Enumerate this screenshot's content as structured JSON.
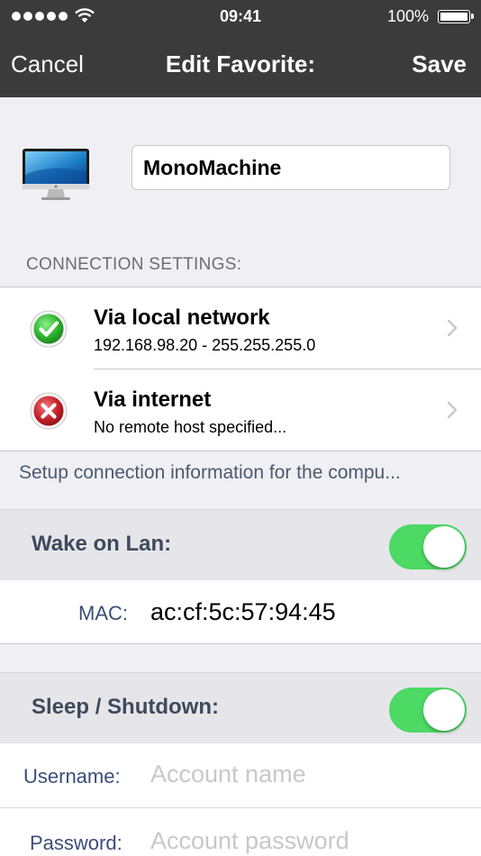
{
  "status_bar": {
    "time": "09:41",
    "battery": "100%",
    "battery_level": 1.0
  },
  "nav": {
    "left": "Cancel",
    "title": "Edit Favorite:",
    "right": "Save"
  },
  "favorite": {
    "icon": "computer-monitor-icon",
    "name": "MonoMachine"
  },
  "connection": {
    "header": "CONNECTION SETTINGS:",
    "items": [
      {
        "title": "Via local network",
        "subtitle": "192.168.98.20 - 255.255.255.0",
        "status": "ok",
        "status_icon": "green-checkmark-icon"
      },
      {
        "title": "Via internet",
        "subtitle": "No remote host specified...",
        "status": "error",
        "status_icon": "red-x-icon"
      }
    ],
    "footer": "Setup connection information for the compu..."
  },
  "wake_on_lan": {
    "label": "Wake on Lan:",
    "enabled": true,
    "mac_label": "MAC:",
    "mac_value": "ac:cf:5c:57:94:45"
  },
  "sleep_shutdown": {
    "label": "Sleep / Shutdown:",
    "enabled": true,
    "username_label": "Username:",
    "username_placeholder": "Account name",
    "password_label": "Password:",
    "password_placeholder": "Account password"
  },
  "colors": {
    "nav_bg": "#3b3b3b",
    "switch_on": "#4cd964",
    "ok": "#2fb52f",
    "error": "#c8202a"
  }
}
